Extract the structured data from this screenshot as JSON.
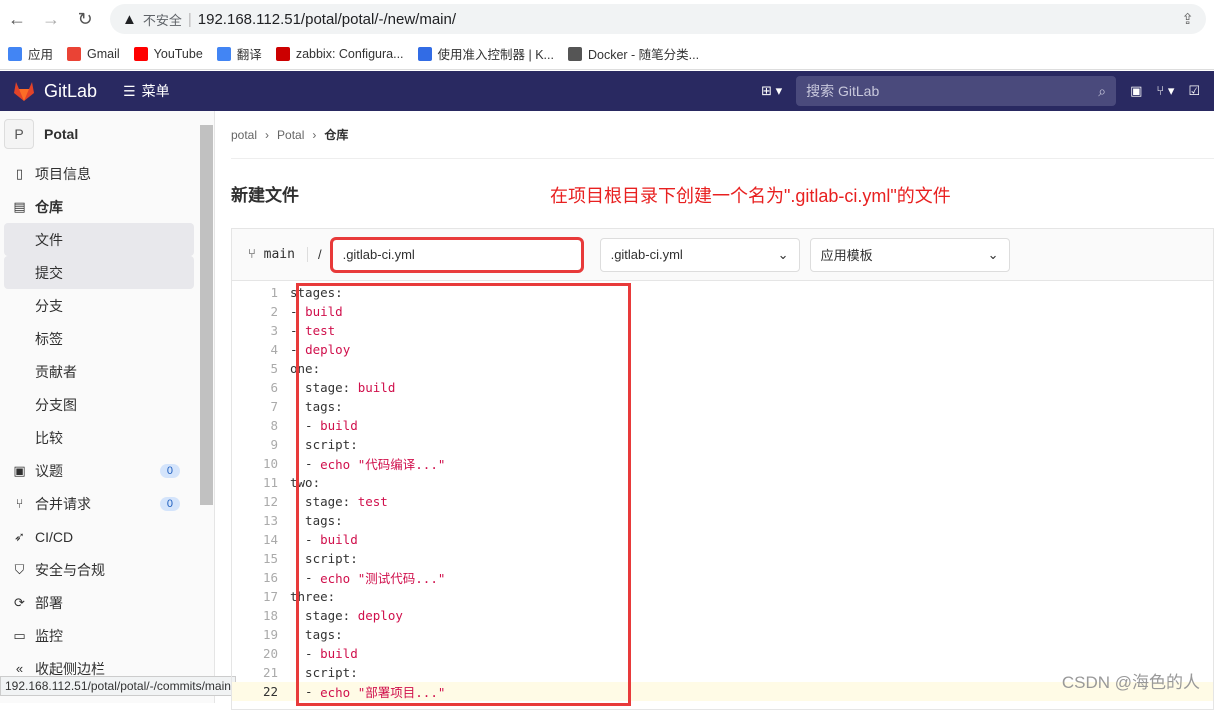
{
  "browser": {
    "insecure": "不安全",
    "url": "192.168.112.51/potal/potal/-/new/main/",
    "bookmarks": [
      "应用",
      "Gmail",
      "YouTube",
      "翻译",
      "zabbix: Configura...",
      "使用准入控制器 | K...",
      "Docker - 随笔分类..."
    ]
  },
  "header": {
    "brand": "GitLab",
    "menu": "菜单",
    "search_placeholder": "搜索 GitLab"
  },
  "sidebar": {
    "project_initial": "P",
    "project": "Potal",
    "items": [
      {
        "label": "项目信息",
        "icon": "info-icon"
      },
      {
        "label": "仓库",
        "icon": "repo-icon"
      },
      {
        "label": "文件"
      },
      {
        "label": "提交"
      },
      {
        "label": "分支"
      },
      {
        "label": "标签"
      },
      {
        "label": "贡献者"
      },
      {
        "label": "分支图"
      },
      {
        "label": "比较"
      },
      {
        "label": "议题",
        "icon": "issues-icon",
        "badge": "0"
      },
      {
        "label": "合并请求",
        "icon": "merge-icon",
        "badge": "0"
      },
      {
        "label": "CI/CD",
        "icon": "rocket-icon"
      },
      {
        "label": "安全与合规",
        "icon": "shield-icon"
      },
      {
        "label": "部署",
        "icon": "deploy-icon"
      },
      {
        "label": "监控",
        "icon": "monitor-icon"
      },
      {
        "label": "收起侧边栏",
        "icon": "collapse-icon"
      }
    ]
  },
  "status_url": "192.168.112.51/potal/potal/-/commits/main",
  "breadcrumb": [
    "potal",
    "Potal",
    "仓库"
  ],
  "page_title": "新建文件",
  "annotation": "在项目根目录下创建一个名为\".gitlab-ci.yml\"的文件",
  "editor": {
    "branch": "main",
    "separator": "/",
    "file_name": ".gitlab-ci.yml",
    "template_type": ".gitlab-ci.yml",
    "template": "应用模板",
    "lines": [
      [
        [
          "stages:",
          "k"
        ]
      ],
      [
        [
          "- ",
          "k"
        ],
        [
          "build",
          "v"
        ]
      ],
      [
        [
          "- ",
          "k"
        ],
        [
          "test",
          "v"
        ]
      ],
      [
        [
          "- ",
          "k"
        ],
        [
          "deploy",
          "v"
        ]
      ],
      [
        [
          "one:",
          "k"
        ]
      ],
      [
        [
          "  stage: ",
          "k"
        ],
        [
          "build",
          "v"
        ]
      ],
      [
        [
          "  tags:",
          "k"
        ]
      ],
      [
        [
          "  - ",
          "k"
        ],
        [
          "build",
          "v"
        ]
      ],
      [
        [
          "  script:",
          "k"
        ]
      ],
      [
        [
          "  - ",
          "k"
        ],
        [
          "echo \"代码编译...\"",
          "v"
        ]
      ],
      [
        [
          "two:",
          "k"
        ]
      ],
      [
        [
          "  stage: ",
          "k"
        ],
        [
          "test",
          "v"
        ]
      ],
      [
        [
          "  tags:",
          "k"
        ]
      ],
      [
        [
          "  - ",
          "k"
        ],
        [
          "build",
          "v"
        ]
      ],
      [
        [
          "  script:",
          "k"
        ]
      ],
      [
        [
          "  - ",
          "k"
        ],
        [
          "echo \"测试代码...\"",
          "v"
        ]
      ],
      [
        [
          "three:",
          "k"
        ]
      ],
      [
        [
          "  stage: ",
          "k"
        ],
        [
          "deploy",
          "v"
        ]
      ],
      [
        [
          "  tags:",
          "k"
        ]
      ],
      [
        [
          "  - ",
          "k"
        ],
        [
          "build",
          "v"
        ]
      ],
      [
        [
          "  script:",
          "k"
        ]
      ],
      [
        [
          "  - ",
          "k"
        ],
        [
          "echo \"部署项目...\"",
          "v"
        ]
      ]
    ]
  },
  "watermark": "CSDN @海色的人"
}
